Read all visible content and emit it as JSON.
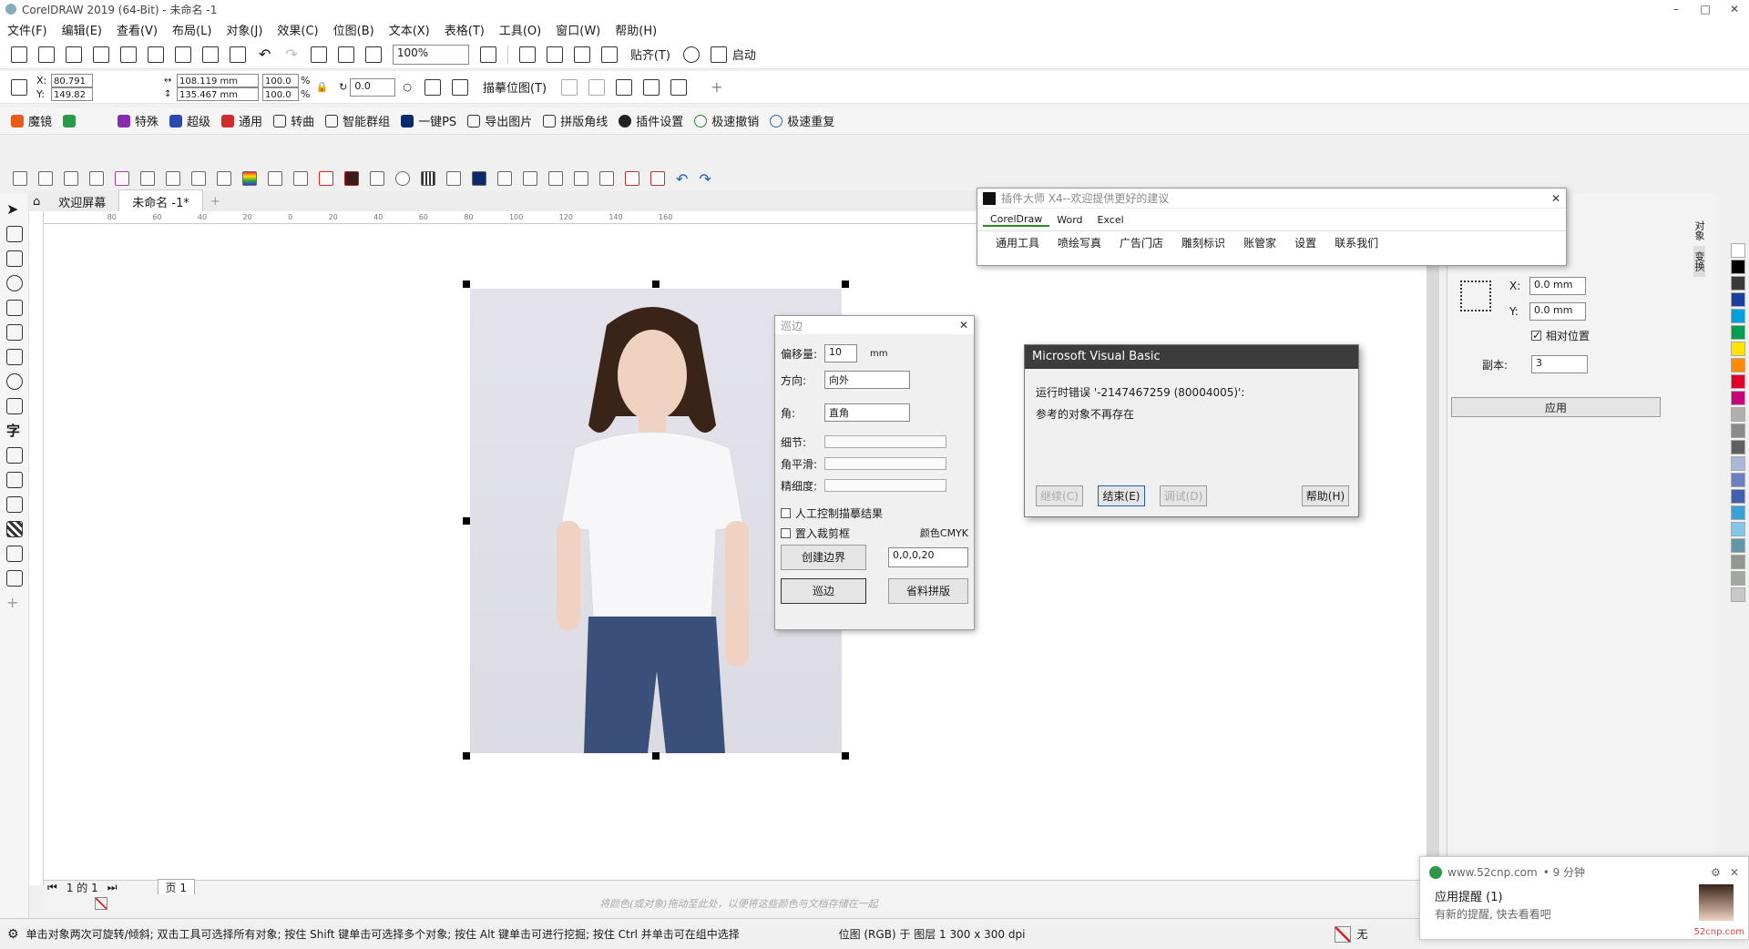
{
  "app": {
    "title": "CorelDRAW 2019 (64-Bit) - 未命名 -1",
    "window_controls": [
      "–",
      "□",
      "✕"
    ]
  },
  "menu": [
    "文件(F)",
    "编辑(E)",
    "查看(V)",
    "布局(L)",
    "对象(J)",
    "效果(C)",
    "位图(B)",
    "文本(X)",
    "表格(T)",
    "工具(O)",
    "窗口(W)",
    "帮助(H)"
  ],
  "toolbar": {
    "zoom": "100%",
    "snap_label": "贴齐(T)",
    "launch_label": "启动"
  },
  "propbar": {
    "x_label": "X:",
    "y_label": "Y:",
    "x_value": "80.791",
    "y_value": "149.82",
    "width": "108.119 mm",
    "height": "135.467 mm",
    "scale_w": "100.0",
    "scale_h": "100.0",
    "percent": "%",
    "rotation": "0.0",
    "trace_label": "描摹位图(T)"
  },
  "plugins": [
    "魔镜",
    "特殊",
    "超级",
    "通用",
    "转曲",
    "智能群组",
    "一键PS",
    "导出图片",
    "拼版角线",
    "插件设置",
    "极速撤销",
    "极速重复"
  ],
  "tabs": {
    "welcome": "欢迎屏幕",
    "doc": "未命名 -1*"
  },
  "ruler_ticks": [
    "80",
    "60",
    "40",
    "20",
    "0",
    "20",
    "40",
    "60",
    "80",
    "100",
    "120",
    "140",
    "160"
  ],
  "dialog_xunbian": {
    "title": "巡边",
    "offset_label": "偏移量:",
    "offset_value": "10",
    "offset_unit": "mm",
    "direction_label": "方向:",
    "direction_value": "向外",
    "corner_label": "角:",
    "corner_value": "直角",
    "detail_label": "细节:",
    "smooth_label": "角平滑:",
    "precision_label": "精细度:",
    "manual_label": "人工控制描摹结果",
    "clip_label": "置入裁剪框",
    "color_label": "颜色CMYK",
    "color_value": "0,0,0,20",
    "create_btn": "创建边界",
    "run_btn": "巡边",
    "save_btn": "省料拼版"
  },
  "dialog_plugin": {
    "title": "插件大师 X4--欢迎提供更好的建议",
    "tabs": [
      "CorelDraw",
      "Word",
      "Excel"
    ],
    "items": [
      "通用工具",
      "喷绘写真",
      "广告门店",
      "雕刻标识",
      "账管家",
      "设置",
      "联系我们"
    ]
  },
  "dialog_vb": {
    "title": "Microsoft Visual Basic",
    "line1": "运行时错误 '-2147467259 (80004005)':",
    "line2": "参考的对象不再存在",
    "btn_continue": "继续(C)",
    "btn_end": "结束(E)",
    "btn_debug": "调试(D)",
    "btn_help": "帮助(H)"
  },
  "docker": {
    "x_label": "X:",
    "y_label": "Y:",
    "x_value": "0.0 mm",
    "y_value": "0.0 mm",
    "relative_label": "相对位置",
    "copies_label": "副本:",
    "copies_value": "3",
    "apply_label": "应用",
    "side_tabs": [
      "对象",
      "变换"
    ]
  },
  "pagebar": {
    "page_of": "1 的 1",
    "page_tab": "页 1"
  },
  "colorbar_hint": "将颜色(或对象)拖动至此处，以便将这些颜色与文档存储在一起",
  "status": {
    "hint": "单击对象两次可旋转/倾斜; 双击工具可选择所有对象; 按住 Shift 键单击可选择多个对象; 按住 Alt 键单击可进行挖掘; 按住 Ctrl 并单击可在组中选择",
    "position": "位图 (RGB) 于 图层 1 300 x 300 dpi",
    "fill_none": "无"
  },
  "notification": {
    "site": "www.52cnp.com",
    "time": "• 9 分钟",
    "title": "应用提醒 (1)",
    "body": "有新的提醒, 快去看看吧",
    "watermark": "52cnp.com"
  },
  "palette": [
    "#ffffff",
    "#000000",
    "#3a3a3a",
    "#1a3fa0",
    "#00a0e0",
    "#00a050",
    "#ffe400",
    "#ff8c00",
    "#e0002a",
    "#c8007a",
    "#b0b0b0",
    "#8a8a8a",
    "#606060",
    "#a8b8d8",
    "#6a80c0",
    "#4060b0",
    "#3aa0d8",
    "#80c8e8",
    "#6098a8",
    "#909890",
    "#a0a8a0",
    "#c8c8c8"
  ],
  "colors": {
    "vb_title": "#3c3c3c",
    "accent": "#1a5fb4"
  }
}
